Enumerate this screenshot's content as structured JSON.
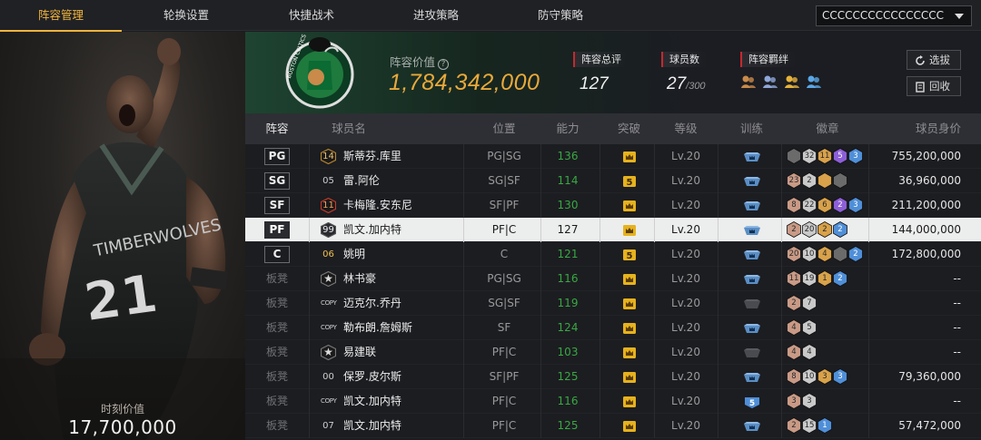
{
  "nav": {
    "tabs": [
      "阵容管理",
      "轮换设置",
      "快捷战术",
      "进攻策略",
      "防守策略"
    ],
    "active_tab": 0,
    "lineup_select_value": "CCCCCCCCCCCCCCCC"
  },
  "hero": {
    "value_label": "时刻价值",
    "value": "17,700,000"
  },
  "summary": {
    "value_label": "阵容价值",
    "value": "1,784,342,000",
    "rating_label": "阵容总评",
    "rating": "127",
    "player_count_label": "球员数",
    "player_count": "27",
    "player_count_max": "/300",
    "chemistry_label": "阵容羁绊",
    "chemistry_icon_colors": [
      "#c98a4a",
      "#8fa6d8",
      "#e6b23c",
      "#5aa7e6"
    ],
    "buttons": {
      "pick": "选拔",
      "recycle": "回收"
    },
    "team_logo_text": "BOSTON CELTICS"
  },
  "table": {
    "headers": [
      "阵容",
      "球员名",
      "位置",
      "能力",
      "突破",
      "等级",
      "训练",
      "徽章",
      "球员身价"
    ],
    "rows": [
      {
        "slot": "PG",
        "starter": true,
        "jersey": "14",
        "jersey_style": "gold",
        "name": "斯蒂芬.库里",
        "position": "PG|SG",
        "ability": "136",
        "breakthrough": "crown",
        "level": "Lv.20",
        "training": "crown",
        "badges": [
          [
            "#6b6b6b",
            ""
          ],
          [
            "#c9c9c9",
            "32"
          ],
          [
            "#d9a24a",
            "11"
          ],
          [
            "#8d5fd6",
            "5"
          ],
          [
            "#4f8fd8",
            "3"
          ]
        ],
        "value": "755,200,000"
      },
      {
        "slot": "SG",
        "starter": true,
        "jersey": "05",
        "jersey_style": "plain",
        "name": "雷.阿伦",
        "position": "SG|SF",
        "ability": "114",
        "breakthrough": "5",
        "level": "Lv.20",
        "training": "crown",
        "badges": [
          [
            "#c99a86",
            "23"
          ],
          [
            "#c9c9c9",
            "2"
          ],
          [
            "#d9a24a",
            ""
          ],
          [
            "#6b6b6b",
            ""
          ]
        ],
        "value": "36,960,000"
      },
      {
        "slot": "SF",
        "starter": true,
        "jersey": "11",
        "jersey_style": "red",
        "name": "卡梅隆.安东尼",
        "position": "SF|PF",
        "ability": "130",
        "breakthrough": "crown",
        "level": "Lv.20",
        "training": "crown",
        "badges": [
          [
            "#c99a86",
            "8"
          ],
          [
            "#c9c9c9",
            "22"
          ],
          [
            "#d9a24a",
            "6"
          ],
          [
            "#8d5fd6",
            "2"
          ],
          [
            "#4f8fd8",
            "3"
          ]
        ],
        "value": "211,200,000"
      },
      {
        "slot": "PF",
        "starter": true,
        "selected": true,
        "jersey": "99",
        "jersey_style": "dark",
        "name": "凯文.加内特",
        "position": "PF|C",
        "ability": "127",
        "breakthrough": "crown",
        "level": "Lv.20",
        "training": "crown",
        "badges": [
          [
            "#c99a86",
            "2"
          ],
          [
            "#c9c9c9",
            "20"
          ],
          [
            "#d9a24a",
            "2"
          ],
          [
            "#4f8fd8",
            "2"
          ]
        ],
        "value": "144,000,000"
      },
      {
        "slot": "C",
        "starter": true,
        "jersey": "06",
        "jersey_style": "plain-gold",
        "name": "姚明",
        "position": "C",
        "ability": "121",
        "breakthrough": "5",
        "level": "Lv.20",
        "training": "crown",
        "badges": [
          [
            "#c99a86",
            "20"
          ],
          [
            "#c9c9c9",
            "10"
          ],
          [
            "#d9a24a",
            "4"
          ],
          [
            "#6b6b6b",
            ""
          ],
          [
            "#4f8fd8",
            "2"
          ]
        ],
        "value": "172,800,000"
      },
      {
        "slot": "板凳",
        "starter": false,
        "jersey": "★",
        "jersey_style": "star",
        "name": "林书豪",
        "position": "PG|SG",
        "ability": "116",
        "breakthrough": "crown",
        "level": "Lv.20",
        "training": "crown",
        "badges": [
          [
            "#c99a86",
            "11"
          ],
          [
            "#c9c9c9",
            "19"
          ],
          [
            "#d9a24a",
            "1"
          ],
          [
            "#4f8fd8",
            "2"
          ]
        ],
        "value": "--"
      },
      {
        "slot": "板凳",
        "starter": false,
        "jersey": "COPY",
        "jersey_style": "copy",
        "name": "迈克尔.乔丹",
        "position": "SG|SF",
        "ability": "119",
        "breakthrough": "crown",
        "level": "Lv.20",
        "training": "none",
        "badges": [
          [
            "#c99a86",
            "2"
          ],
          [
            "#c9c9c9",
            "7"
          ]
        ],
        "value": "--"
      },
      {
        "slot": "板凳",
        "starter": false,
        "jersey": "COPY",
        "jersey_style": "copy",
        "name": "勒布朗.詹姆斯",
        "position": "SF",
        "ability": "124",
        "breakthrough": "crown",
        "level": "Lv.20",
        "training": "crown",
        "badges": [
          [
            "#c99a86",
            "4"
          ],
          [
            "#c9c9c9",
            "5"
          ]
        ],
        "value": "--"
      },
      {
        "slot": "板凳",
        "starter": false,
        "jersey": "★",
        "jersey_style": "star",
        "name": "易建联",
        "position": "PF|C",
        "ability": "103",
        "breakthrough": "crown",
        "level": "Lv.20",
        "training": "none",
        "badges": [
          [
            "#c99a86",
            "4"
          ],
          [
            "#c9c9c9",
            "4"
          ]
        ],
        "value": "--"
      },
      {
        "slot": "板凳",
        "starter": false,
        "jersey": "00",
        "jersey_style": "plain",
        "name": "保罗.皮尔斯",
        "position": "SF|PF",
        "ability": "125",
        "breakthrough": "crown",
        "level": "Lv.20",
        "training": "crown",
        "badges": [
          [
            "#c99a86",
            "8"
          ],
          [
            "#c9c9c9",
            "10"
          ],
          [
            "#d9a24a",
            "3"
          ],
          [
            "#4f8fd8",
            "3"
          ]
        ],
        "value": "79,360,000"
      },
      {
        "slot": "板凳",
        "starter": false,
        "jersey": "COPY",
        "jersey_style": "copy",
        "name": "凯文.加内特",
        "position": "PF|C",
        "ability": "116",
        "breakthrough": "crown",
        "level": "Lv.20",
        "training": "5",
        "badges": [
          [
            "#c99a86",
            "3"
          ],
          [
            "#c9c9c9",
            "3"
          ]
        ],
        "value": "--"
      },
      {
        "slot": "板凳",
        "starter": false,
        "jersey": "07",
        "jersey_style": "plain",
        "name": "凯文.加内特",
        "position": "PF|C",
        "ability": "125",
        "breakthrough": "crown",
        "level": "Lv.20",
        "training": "crown",
        "badges": [
          [
            "#c99a86",
            "2"
          ],
          [
            "#c9c9c9",
            "15"
          ],
          [
            "#4f8fd8",
            "1"
          ]
        ],
        "value": "57,472,000"
      }
    ]
  }
}
